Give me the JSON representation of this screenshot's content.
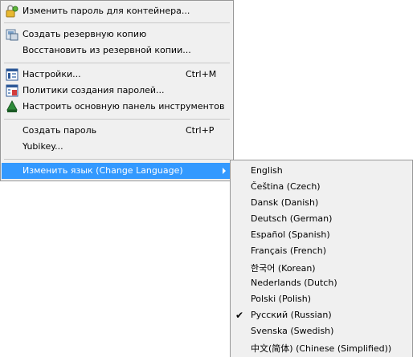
{
  "main_menu": {
    "change_password": "Изменить пароль для контейнера...",
    "backup": "Создать резервную копию",
    "restore": "Восстановить из резервной копии...",
    "settings": "Настройки...",
    "settings_shortcut": "Ctrl+M",
    "password_policies": "Политики создания паролей...",
    "customize_toolbar": "Настроить основную панель инструментов",
    "generate_password": "Создать пароль",
    "generate_password_shortcut": "Ctrl+P",
    "yubikey": "Yubikey...",
    "change_language": "Изменить язык (Change Language)"
  },
  "language_menu": {
    "items": [
      "English",
      "Čeština (Czech)",
      "Dansk (Danish)",
      "Deutsch (German)",
      "Español (Spanish)",
      "Français (French)",
      "한국어 (Korean)",
      "Nederlands (Dutch)",
      "Polski (Polish)",
      "Русский (Russian)",
      "Svenska (Swedish)",
      "中文(简体) (Chinese (Simplified))"
    ],
    "checked_index": 9,
    "check_glyph": "✔"
  },
  "colors": {
    "highlight": "#3399ff",
    "menu_bg": "#f0f0f0"
  }
}
